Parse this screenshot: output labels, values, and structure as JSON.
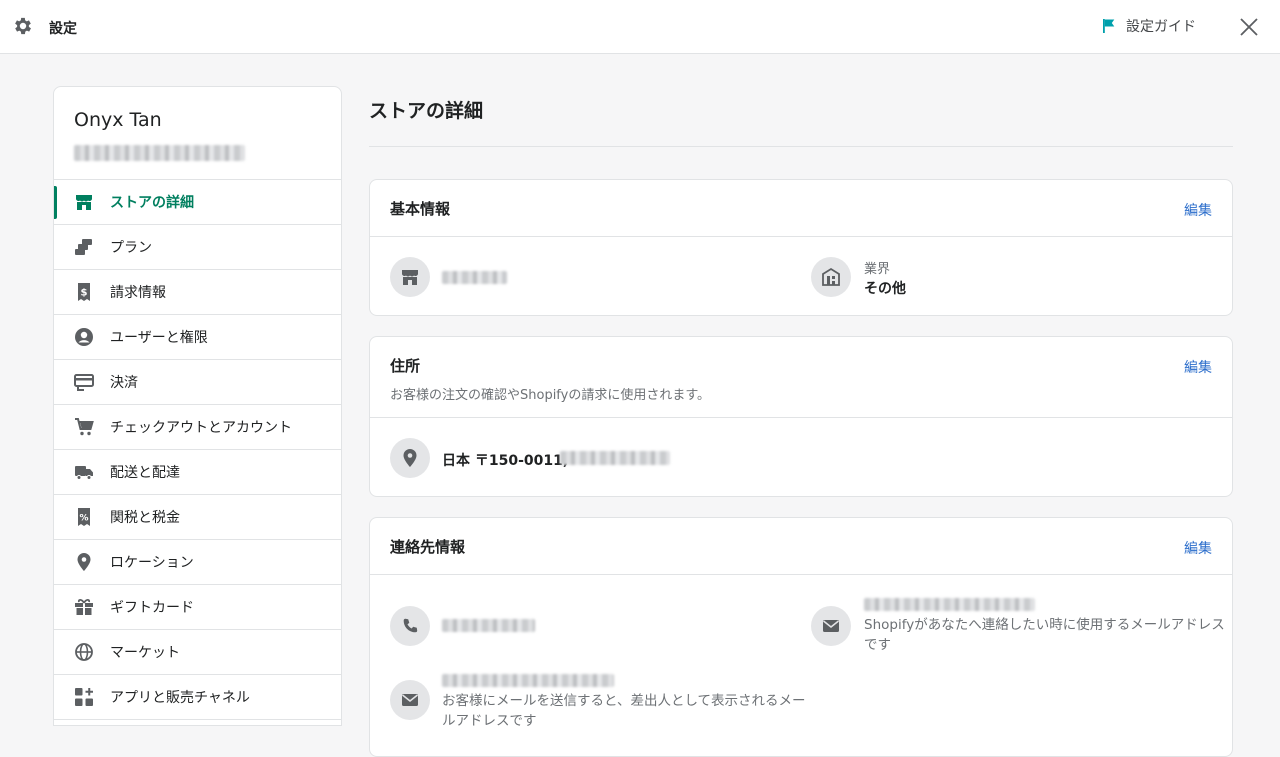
{
  "topbar": {
    "title": "設定",
    "guide_label": "設定ガイド"
  },
  "sidebar": {
    "store_name": "Onyx Tan",
    "items": [
      {
        "label": "ストアの詳細",
        "icon": "store-icon",
        "active": true
      },
      {
        "label": "プラン",
        "icon": "plan-icon"
      },
      {
        "label": "請求情報",
        "icon": "billing-icon"
      },
      {
        "label": "ユーザーと権限",
        "icon": "user-icon"
      },
      {
        "label": "決済",
        "icon": "payment-icon"
      },
      {
        "label": "チェックアウトとアカウント",
        "icon": "cart-icon"
      },
      {
        "label": "配送と配達",
        "icon": "truck-icon"
      },
      {
        "label": "関税と税金",
        "icon": "tax-icon"
      },
      {
        "label": "ロケーション",
        "icon": "location-icon"
      },
      {
        "label": "ギフトカード",
        "icon": "gift-icon"
      },
      {
        "label": "マーケット",
        "icon": "globe-icon"
      },
      {
        "label": "アプリと販売チャネル",
        "icon": "apps-icon"
      }
    ]
  },
  "main": {
    "title": "ストアの詳細",
    "basic": {
      "title": "基本情報",
      "edit": "編集",
      "industry_label": "業界",
      "industry_value": "その他"
    },
    "address": {
      "title": "住所",
      "edit": "編集",
      "subtitle": "お客様の注文の確認やShopifyの請求に使用されます。",
      "value": "日本 〒150-0011,"
    },
    "contact": {
      "title": "連絡先情報",
      "edit": "編集",
      "email_note_right": "Shopifyがあなたへ連絡したい時に使用するメールアドレスです",
      "email_note_left": "お客様にメールを送信すると、差出人として表示されるメールアドレスです"
    }
  },
  "colors": {
    "accent": "#008060",
    "link": "#2c6ecb",
    "guide_flag": "#00a0ac"
  }
}
